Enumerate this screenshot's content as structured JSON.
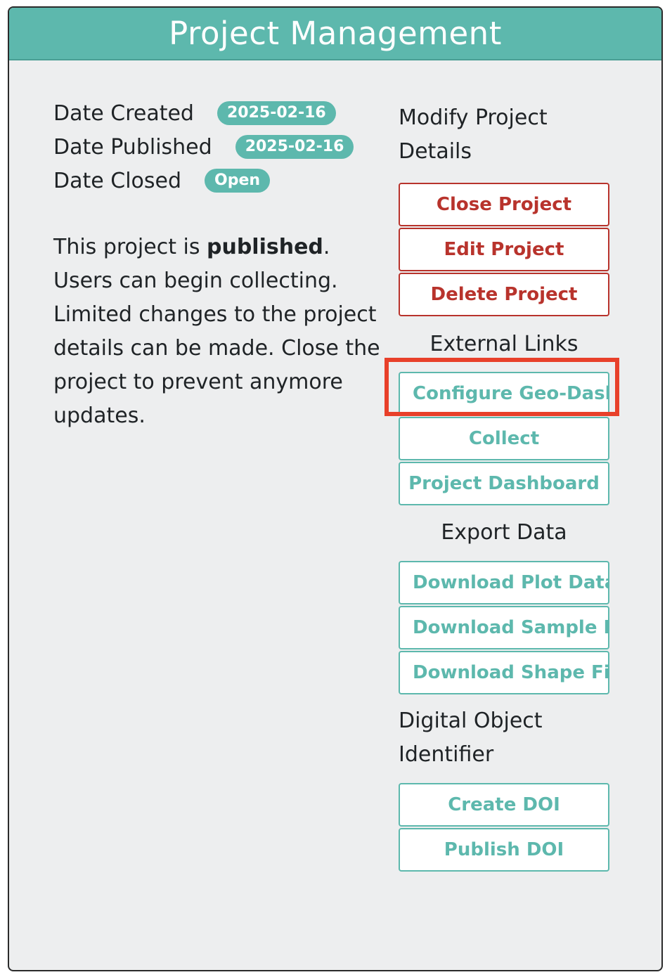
{
  "header": {
    "title": "Project Management"
  },
  "dates": [
    {
      "label": "Date Created",
      "value": "2025-02-16"
    },
    {
      "label": "Date Published",
      "value": "2025-02-16"
    },
    {
      "label": "Date Closed",
      "value": "Open"
    }
  ],
  "description": {
    "prefix": "This project is ",
    "status": "published",
    "suffix": ". Users can begin collecting. Limited changes to the project details can be made. Close the project to prevent anymore updates."
  },
  "modify": {
    "title": "Modify Project Details",
    "buttons": [
      "Close Project",
      "Edit Project",
      "Delete Project"
    ]
  },
  "external": {
    "title": "External Links",
    "buttons": [
      "Configure Geo-Dash",
      "Collect",
      "Project Dashboard"
    ]
  },
  "export": {
    "title": "Export Data",
    "buttons": [
      "Download Plot Data",
      "Download Sample Da",
      "Download Shape File"
    ]
  },
  "doi": {
    "title": "Digital Object Identifier",
    "buttons": [
      "Create DOI",
      "Publish DOI"
    ]
  },
  "colors": {
    "accent": "#5db8ad",
    "danger": "#b8332c",
    "highlight": "#e8402a",
    "panel_bg": "#edeeef"
  }
}
